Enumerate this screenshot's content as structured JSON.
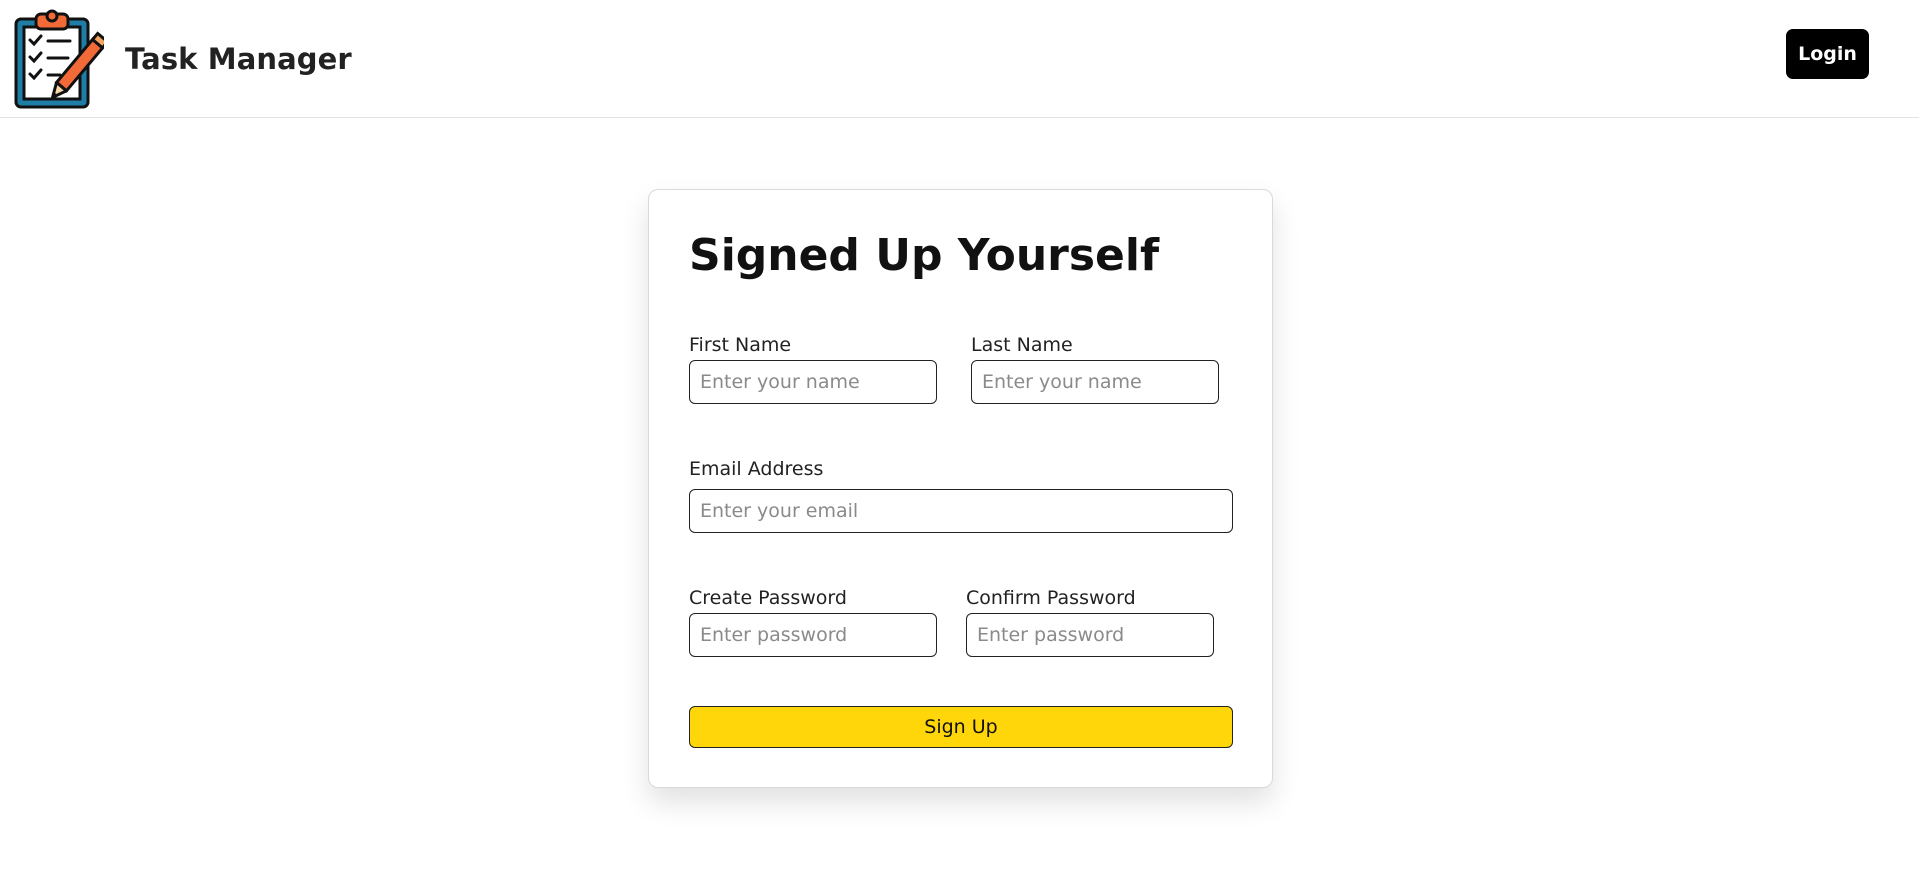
{
  "navbar": {
    "logo_icon": "clipboard-checklist-pencil-icon",
    "brand": "Task Manager",
    "login_label": "Login"
  },
  "form": {
    "title": "Signed Up Yourself",
    "first_name": {
      "label": "First Name",
      "placeholder": "Enter your name",
      "value": ""
    },
    "last_name": {
      "label": "Last Name",
      "placeholder": "Enter your name",
      "value": ""
    },
    "email": {
      "label": "Email Address",
      "placeholder": "Enter your email",
      "value": ""
    },
    "create_password": {
      "label": "Create Password",
      "placeholder": "Enter password",
      "value": ""
    },
    "confirm_password": {
      "label": "Confirm Password",
      "placeholder": "Enter password",
      "value": ""
    },
    "submit_label": "Sign Up"
  },
  "colors": {
    "accent": "#ffd60a",
    "login_button": "#000000",
    "logo_board": "#1f7ea6",
    "logo_pencil": "#f26a38"
  }
}
